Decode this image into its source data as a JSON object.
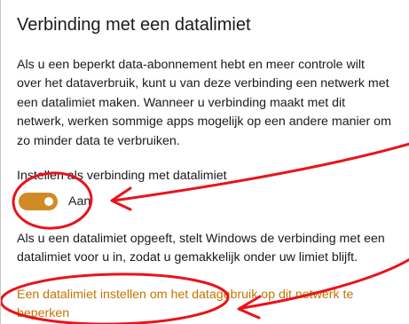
{
  "section": {
    "title": "Verbinding met een datalimiet",
    "description_lines": [
      "Als u een beperkt data-abonnement hebt en meer controle wilt",
      "over het dataverbruik, kunt u van deze verbinding een netwerk met",
      "een datalimiet maken. Wanneer u verbinding maakt met dit",
      "netwerk, werken sommige apps mogelijk op een andere manier om",
      "zo minder data te verbruiken."
    ]
  },
  "metered_toggle": {
    "label": "Instellen als verbinding met datalimiet",
    "state": "Aan",
    "on": true
  },
  "info_lines": [
    "Als u een datalimiet opgeeft, stelt Windows de verbinding met een",
    "datalimiet voor u in, zodat u gemakkelijk onder uw limiet blijft."
  ],
  "link_lines": [
    "Een datalimiet instellen om het datagebruik op dit netwerk te",
    "beperken"
  ],
  "colors": {
    "accent": "#d08b23",
    "link": "#c07500",
    "annotation": "#e8141b"
  }
}
